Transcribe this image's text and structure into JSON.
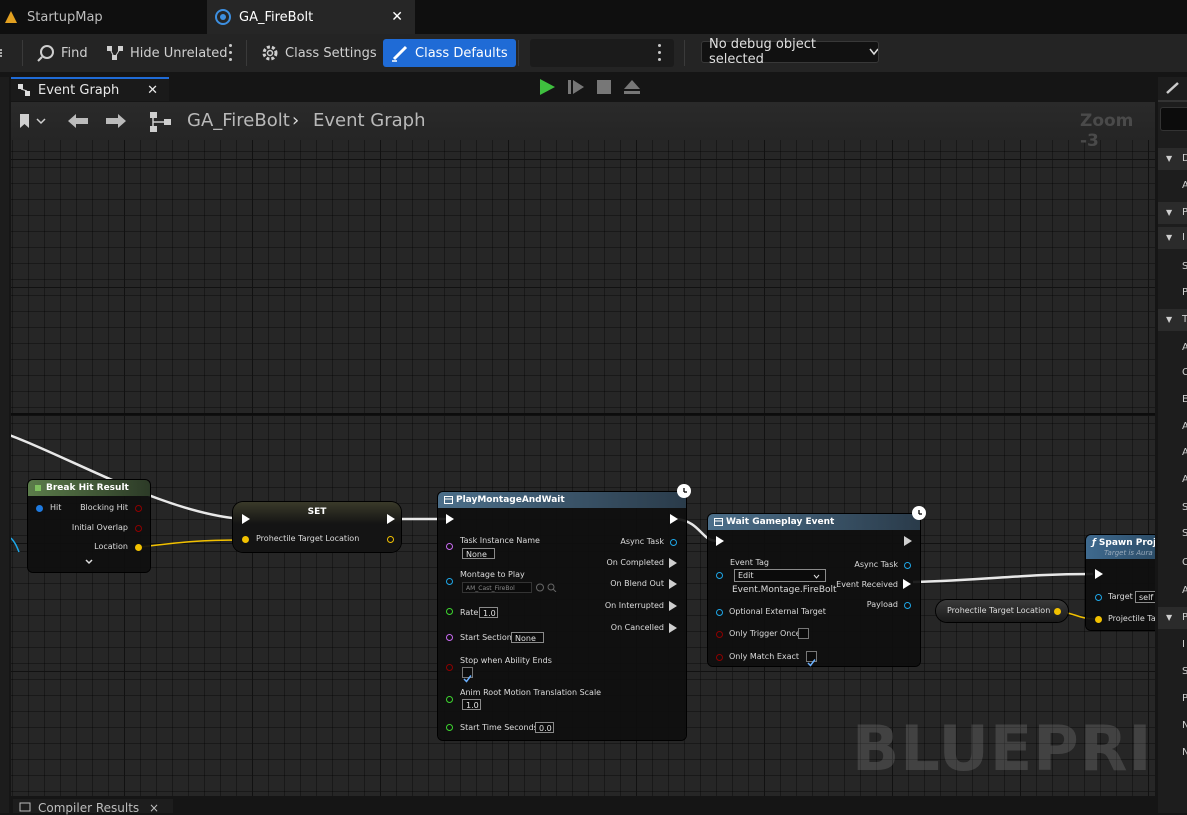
{
  "tabs": [
    {
      "label": "StartupMap",
      "active": false
    },
    {
      "label": "GA_FireBolt",
      "active": true
    }
  ],
  "toolbar": {
    "find": "Find",
    "hide_unrelated": "Hide Unrelated",
    "class_settings": "Class Settings",
    "class_defaults": "Class Defaults",
    "debug_object": "No debug object selected"
  },
  "graph_tab": {
    "label": "Event Graph",
    "close": "×"
  },
  "breadcrumb": {
    "blueprint": "GA_FireBolt",
    "graph": "Event Graph",
    "separator": "›",
    "zoom": "Zoom -3"
  },
  "watermark": "BLUEPRINT",
  "nodes": {
    "break_hit": {
      "title": "Break Hit Result",
      "pins": {
        "hit": "Hit",
        "blocking_hit": "Blocking Hit",
        "initial_overlap": "Initial Overlap",
        "location": "Location"
      }
    },
    "set": {
      "title": "SET",
      "pins": {
        "target_location": "Prohectile Target Location"
      }
    },
    "play_montage": {
      "title": "PlayMontageAndWait",
      "pins": {
        "task_instance_name": "Task Instance Name",
        "task_instance_value": "None",
        "montage_to_play": "Montage to Play",
        "montage_value": "AM_Cast_FireBol",
        "rate": "Rate",
        "rate_value": "1.0",
        "start_section": "Start Section",
        "start_section_value": "None",
        "stop_when_ends": "Stop when Ability Ends",
        "anim_root": "Anim Root Motion Translation Scale",
        "anim_root_value": "1.0",
        "start_time": "Start Time Seconds",
        "start_time_value": "0.0",
        "async_task": "Async Task",
        "on_completed": "On Completed",
        "on_blend_out": "On Blend Out",
        "on_interrupted": "On Interrupted",
        "on_cancelled": "On Cancelled"
      }
    },
    "wait_event": {
      "title": "Wait Gameplay Event",
      "pins": {
        "event_tag": "Event Tag",
        "edit": "Edit",
        "tag_value": "Event.Montage.FireBolt",
        "optional_target": "Optional External Target",
        "only_trigger_once": "Only Trigger Once",
        "only_match_exact": "Only Match Exact",
        "async_task": "Async Task",
        "event_received": "Event Received",
        "payload": "Payload"
      }
    },
    "get_target": {
      "title": "Prohectile Target Location"
    },
    "spawn": {
      "title": "Spawn Proje",
      "subtitle": "Target is Aura",
      "pins": {
        "target": "Target",
        "target_value": "self",
        "proj_target": "Projectile Ta"
      }
    }
  },
  "right_panel": {
    "rows": [
      "D",
      "A",
      "P",
      "I",
      "S",
      "P",
      "T",
      "A",
      "C",
      "E",
      "A",
      "A",
      "A",
      "S",
      "S",
      "C",
      "A",
      "P",
      "I",
      "S",
      "P",
      "N",
      "N"
    ]
  },
  "compiler": {
    "label": "Compiler Results",
    "close": "×"
  },
  "colors": {
    "accent": "#1f6bd6",
    "play": "#3fbf3f",
    "float_pin": "#3dd62f",
    "vector_pin": "#f2c100",
    "object_pin": "#1ea7e8",
    "bool_pin": "#8e0000",
    "name_pin": "#c96bf2"
  }
}
